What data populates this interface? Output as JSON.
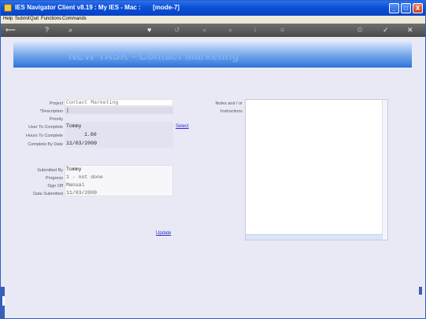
{
  "window": {
    "title": "IES Navigator Client v8.19 : My IES - Mac :       [mode-7]"
  },
  "window_controls": {
    "minimize": "_",
    "maximize": "□",
    "close": "X"
  },
  "menu": [
    "Help",
    "Submit",
    "Quit",
    "Functions",
    "Commands"
  ],
  "toolbar": {
    "back": "⟵",
    "help": "?",
    "search": "⌕",
    "heart": "♥",
    "refresh": "↺",
    "first": "«",
    "last": "»",
    "info": "i",
    "stack": "≡",
    "settings": "⚙",
    "ok": "✓",
    "cancel": "✕"
  },
  "banner": {
    "heading": "NEW TASK - Contact Marketing"
  },
  "form": {
    "project": {
      "label": "Project",
      "value": "Contact Marketing"
    },
    "description": {
      "label": "*Description",
      "value": "|"
    },
    "priority": {
      "label": "Priority",
      "value": ""
    },
    "user_to_complete": {
      "label": "User To Complete",
      "value": "Tommy"
    },
    "hours_to_complete": {
      "label": "Hours To Complete",
      "value": "1.00"
    },
    "complete_by_date": {
      "label": "Complete By Date",
      "value": "11/03/2009"
    },
    "select_link": "Select",
    "submitted_by": {
      "label": "Submitted By",
      "value": "Tommy"
    },
    "progress": {
      "label": "Progress",
      "value": "1 - not done"
    },
    "sign_off": {
      "label": "Sign Off",
      "value": "Manual"
    },
    "date_submitted": {
      "label": "Date Submitted",
      "value": "11/03/2009"
    },
    "update_link": "Update"
  },
  "notes": {
    "label_line1": "Notes and / or",
    "label_line2": "Instructions",
    "value": ""
  }
}
